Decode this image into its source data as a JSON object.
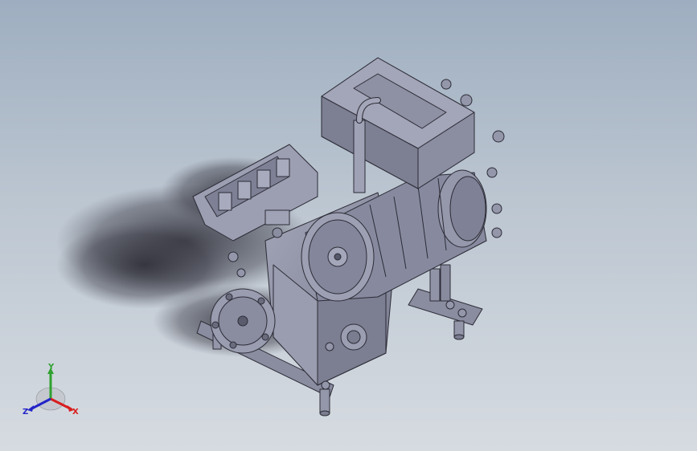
{
  "viewport": {
    "background_top": "#9eaec0",
    "background_bottom": "#d6dbe1"
  },
  "model": {
    "description_icon": "compressor-3d-model",
    "body_color": "#8d8fa3",
    "edge_color": "#2c2c36"
  },
  "triad": {
    "x_label": "X",
    "y_label": "Y",
    "z_label": "Z",
    "x_color": "#d81e1e",
    "y_color": "#2fa12f",
    "z_color": "#2323c8"
  }
}
